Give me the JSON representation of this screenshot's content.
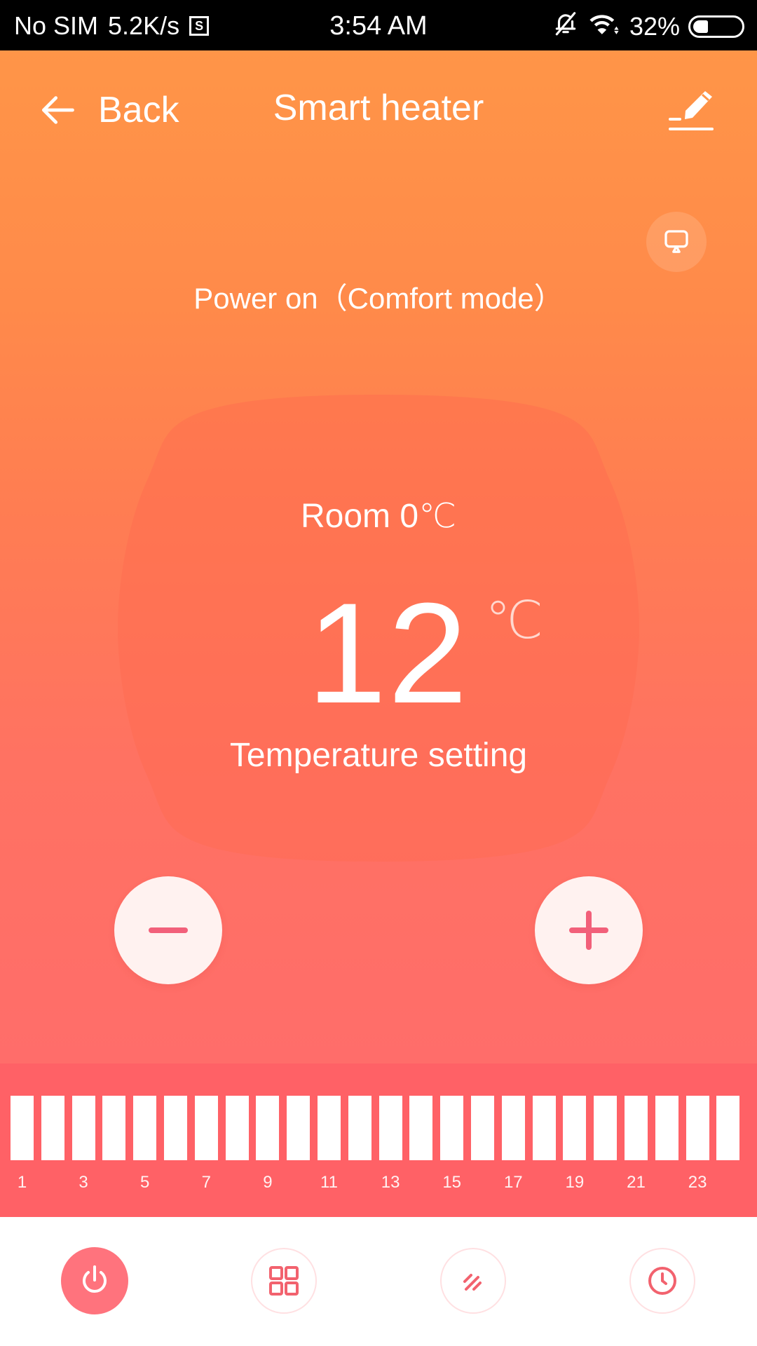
{
  "status_bar": {
    "carrier": "No SIM",
    "net_speed": "5.2K/s",
    "s_badge": "S",
    "time": "3:54 AM",
    "battery_percent": "32%",
    "battery_level": 0.32,
    "icons": [
      "silent-bell-icon",
      "wifi-icon",
      "battery-icon"
    ]
  },
  "header": {
    "back_label": "Back",
    "title": "Smart heater",
    "edit_icon": "edit-pencil-icon"
  },
  "device": {
    "display_icon": "monitor-icon",
    "status_text": "Power on（Comfort mode）",
    "room_label": "Room 0℃",
    "setpoint_value": "12",
    "setpoint_unit": "℃",
    "setpoint_label": "Temperature setting"
  },
  "controls": {
    "decrease_icon": "minus-icon",
    "increase_icon": "plus-icon"
  },
  "schedule": {
    "hours": [
      {
        "hour": 1,
        "on": true
      },
      {
        "hour": 2,
        "on": true
      },
      {
        "hour": 3,
        "on": true
      },
      {
        "hour": 4,
        "on": true
      },
      {
        "hour": 5,
        "on": true
      },
      {
        "hour": 6,
        "on": true
      },
      {
        "hour": 7,
        "on": true
      },
      {
        "hour": 8,
        "on": true
      },
      {
        "hour": 9,
        "on": true
      },
      {
        "hour": 10,
        "on": true
      },
      {
        "hour": 11,
        "on": true
      },
      {
        "hour": 12,
        "on": true
      },
      {
        "hour": 13,
        "on": true
      },
      {
        "hour": 14,
        "on": true
      },
      {
        "hour": 15,
        "on": true
      },
      {
        "hour": 16,
        "on": true
      },
      {
        "hour": 17,
        "on": true
      },
      {
        "hour": 18,
        "on": true
      },
      {
        "hour": 19,
        "on": true
      },
      {
        "hour": 20,
        "on": true
      },
      {
        "hour": 21,
        "on": true
      },
      {
        "hour": 22,
        "on": true
      },
      {
        "hour": 23,
        "on": true
      },
      {
        "hour": 24,
        "on": true
      }
    ],
    "labels": [
      "1",
      "3",
      "5",
      "7",
      "9",
      "11",
      "13",
      "15",
      "17",
      "19",
      "21",
      "23"
    ]
  },
  "bottom_nav": [
    {
      "icon": "power-icon",
      "active": true
    },
    {
      "icon": "modes-grid-icon",
      "active": false
    },
    {
      "icon": "fan-stripes-icon",
      "active": false
    },
    {
      "icon": "timer-clock-icon",
      "active": false
    }
  ],
  "colors": {
    "accent": "#ff737d",
    "gradient_top": "#ff9548",
    "gradient_bottom": "#ff6d6a",
    "strip": "#ff6166"
  }
}
